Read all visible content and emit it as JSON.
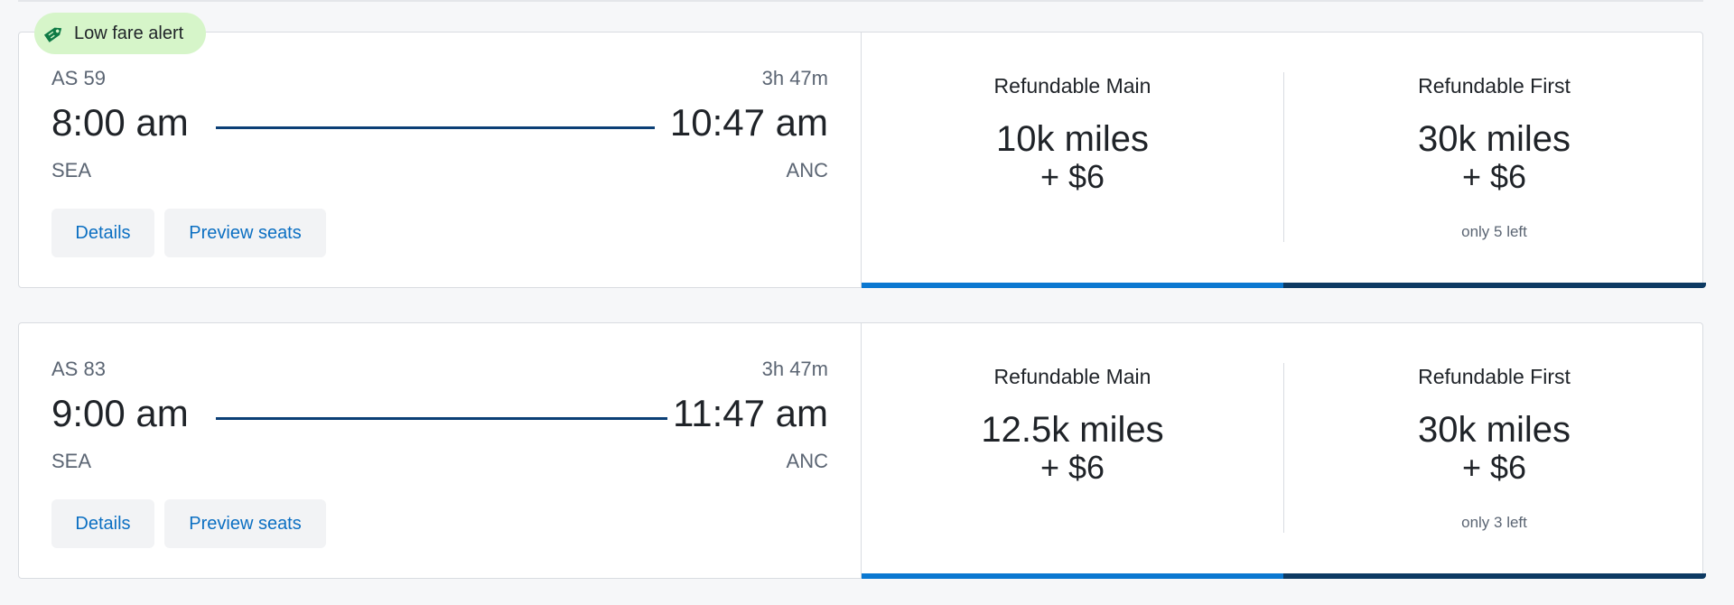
{
  "low_fare_badge": {
    "label": "Low fare alert",
    "icon": "tag-icon"
  },
  "flights": [
    {
      "flight_number": "AS 59",
      "duration": "3h 47m",
      "departure_time": "8:00 am",
      "arrival_time": "10:47 am",
      "origin": "SEA",
      "destination": "ANC",
      "details_label": "Details",
      "preview_label": "Preview seats",
      "fares": [
        {
          "name": "Refundable Main",
          "miles": "10k miles",
          "cash": "+ $6",
          "seats_left": ""
        },
        {
          "name": "Refundable First",
          "miles": "30k miles",
          "cash": "+ $6",
          "seats_left": "only 5 left"
        }
      ]
    },
    {
      "flight_number": "AS 83",
      "duration": "3h 47m",
      "departure_time": "9:00 am",
      "arrival_time": "11:47 am",
      "origin": "SEA",
      "destination": "ANC",
      "details_label": "Details",
      "preview_label": "Preview seats",
      "fares": [
        {
          "name": "Refundable Main",
          "miles": "12.5k miles",
          "cash": "+ $6",
          "seats_left": ""
        },
        {
          "name": "Refundable First",
          "miles": "30k miles",
          "cash": "+ $6",
          "seats_left": "only 3 left"
        }
      ]
    }
  ],
  "colors": {
    "main_bar": "#0b78d1",
    "first_bar": "#0d3a63",
    "link": "#0b6fc2",
    "badge_bg": "#d6f5c9",
    "route_line": "#0b3f76"
  }
}
